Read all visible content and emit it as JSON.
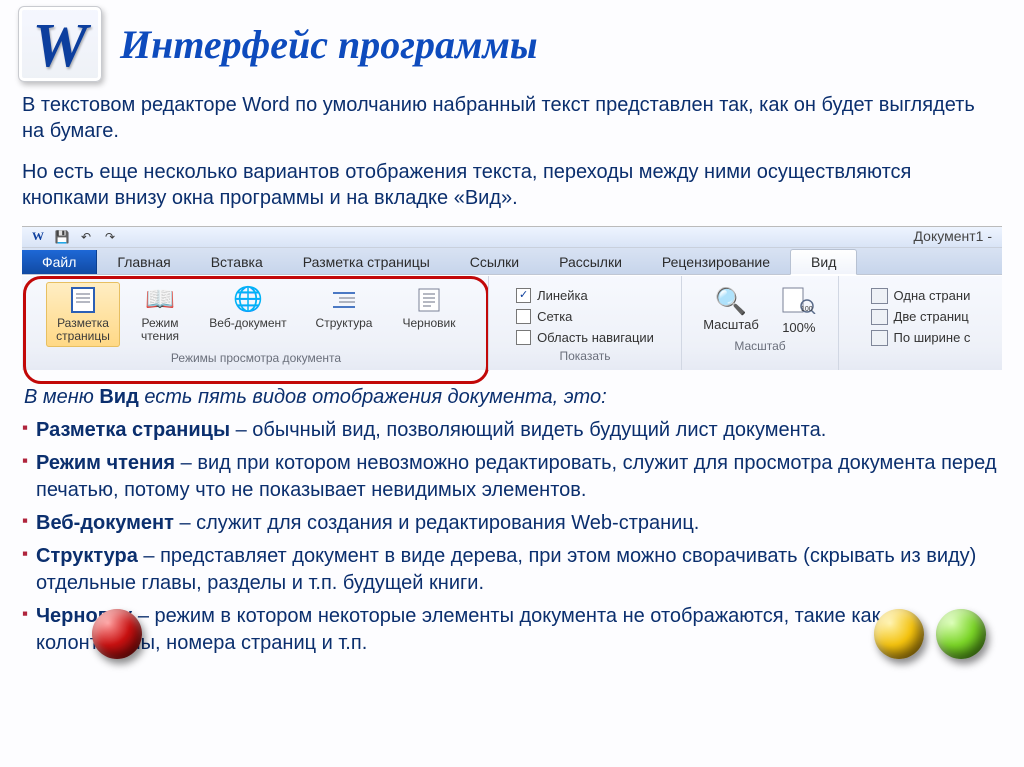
{
  "title": "Интерфейс программы",
  "intro1": "В текстовом редакторе Word по умолчанию набранный текст представлен так, как он будет выглядеть на бумаге.",
  "intro2": "Но есть еще несколько вариантов отображения текста, переходы между ними осуществляются кнопками внизу окна программы и на вкладке «Вид».",
  "ribbon": {
    "doc_title": "Документ1 -",
    "tabs": {
      "file": "Файл",
      "home": "Главная",
      "insert": "Вставка",
      "layout": "Разметка страницы",
      "refs": "Ссылки",
      "mail": "Рассылки",
      "review": "Рецензирование",
      "view": "Вид"
    },
    "views": {
      "print_layout_l1": "Разметка",
      "print_layout_l2": "страницы",
      "reading_l1": "Режим",
      "reading_l2": "чтения",
      "web": "Веб-документ",
      "outline": "Структура",
      "draft": "Черновик",
      "group_label": "Режимы просмотра документа"
    },
    "show": {
      "ruler": "Линейка",
      "grid": "Сетка",
      "nav": "Область навигации",
      "group_label": "Показать"
    },
    "zoom": {
      "label": "Масштаб",
      "value": "100%",
      "group_label": "Масштаб"
    },
    "width": {
      "one": "Одна страни",
      "two": "Две страниц",
      "fit": "По ширине с"
    }
  },
  "lead_pre": "В меню ",
  "lead_bold": "Вид",
  "lead_post": " есть пять видов отображения документа, это:",
  "bullets": [
    {
      "term": "Разметка страницы",
      "rest": " – обычный вид, позволяющий видеть будущий лист документа."
    },
    {
      "term": "Режим чтения",
      "rest": " – вид при котором невозможно редактировать, служит для просмотра документа перед печатью, потому что не показывает невидимых элементов."
    },
    {
      "term": "Веб-документ",
      "rest": " – служит для создания и редактирования Web-страниц."
    },
    {
      "term": "Структура",
      "rest": " – представляет документ в виде дерева, при этом можно сворачивать (скрывать из виду) отдельные главы, разделы и т.п. будущей книги."
    },
    {
      "term": "Черновик",
      "rest": " – режим в котором некоторые элементы документа не отображаются, такие как колонтитулы, номера страниц и т.п."
    }
  ]
}
